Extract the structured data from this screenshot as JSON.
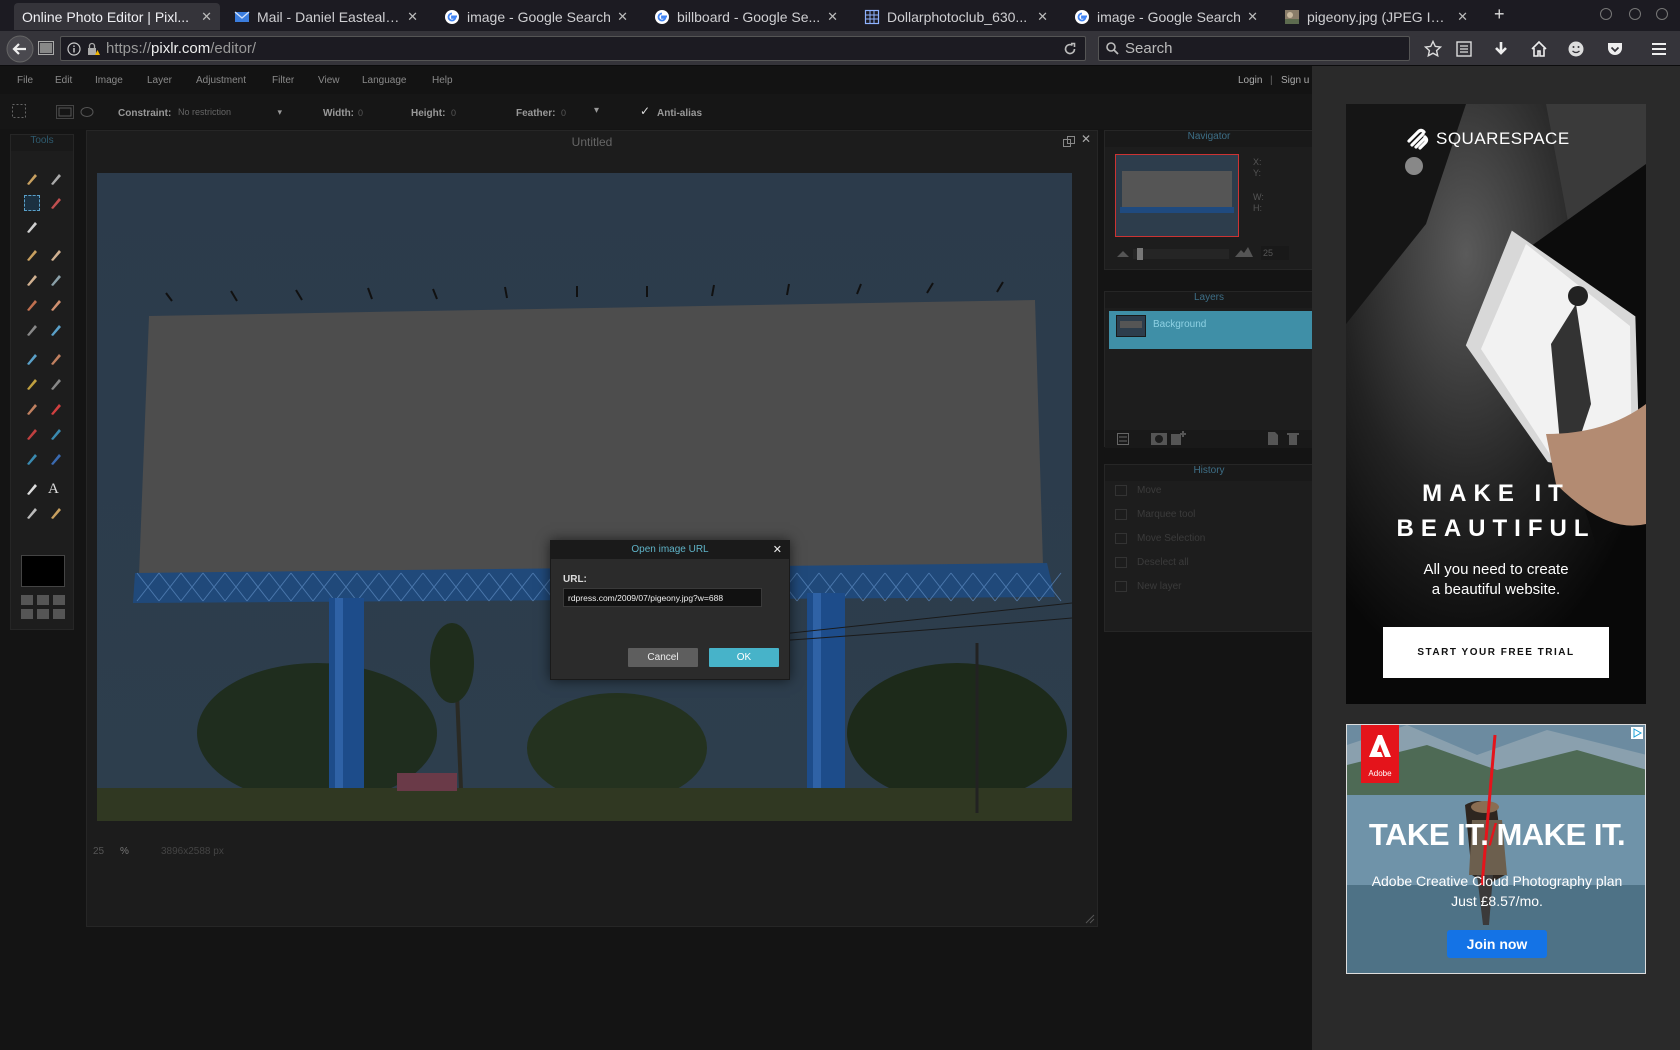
{
  "browser": {
    "tabs": [
      {
        "title": "Online Photo Editor | Pixl...",
        "favicon": "pixlr-icon",
        "active": true
      },
      {
        "title": "Mail - Daniel Easteal -...",
        "favicon": "mail-icon"
      },
      {
        "title": "image - Google Search",
        "favicon": "google-icon"
      },
      {
        "title": "billboard - Google Se...",
        "favicon": "google-icon"
      },
      {
        "title": "Dollarphotoclub_630...",
        "favicon": "image-file-icon"
      },
      {
        "title": "image - Google Search",
        "favicon": "google-icon"
      },
      {
        "title": "pigeony.jpg (JPEG Ima...",
        "favicon": "image-thumb-icon"
      }
    ],
    "url_prefix": "https://",
    "url_domain": "pixlr.com",
    "url_path": "/editor/",
    "search_placeholder": "Search"
  },
  "pixlr": {
    "menu": [
      "File",
      "Edit",
      "Image",
      "Layer",
      "Adjustment",
      "Filter",
      "View",
      "Language",
      "Help"
    ],
    "login": "Login",
    "separator": "|",
    "signup": "Sign u",
    "options": {
      "constraint_label": "Constraint:",
      "constraint_value": "No restriction",
      "width_label": "Width:",
      "width_value": "0",
      "height_label": "Height:",
      "height_value": "0",
      "feather_label": "Feather:",
      "feather_value": "0",
      "antialias_label": "Anti-alias",
      "antialias_checked": true
    },
    "tools_title": "Tools",
    "canvas_title": "Untitled",
    "status": {
      "zoom": "25",
      "unit": "%",
      "size": "3896x2588 px"
    },
    "navigator": {
      "title": "Navigator",
      "x": "X:",
      "y": "Y:",
      "w": "W:",
      "h": "H:",
      "zoom": "25"
    },
    "layers": {
      "title": "Layers",
      "items": [
        "Background"
      ]
    },
    "history": {
      "title": "History",
      "items": [
        "Move",
        "Marquee tool",
        "Move Selection",
        "Deselect all",
        "New layer"
      ]
    }
  },
  "dialog": {
    "title": "Open image URL",
    "url_label": "URL:",
    "url_value": "rdpress.com/2009/07/pigeony.jpg?w=688",
    "cancel": "Cancel",
    "ok": "OK"
  },
  "ads": {
    "squarespace": {
      "brand": "SQUARESPACE",
      "headline_line1": "MAKE IT",
      "headline_line2": "BEAUTIFUL",
      "tagline_line1": "All you need to create",
      "tagline_line2": "a beautiful website.",
      "cta": "START YOUR FREE TRIAL"
    },
    "adobe": {
      "logo_text": "Adobe",
      "headline_part1": "TAKE IT.",
      "headline_part2": "MAKE IT.",
      "line1": "Adobe Creative Cloud Photography plan",
      "line2": "Just £8.57/mo.",
      "cta": "Join now"
    }
  },
  "colors": {
    "accent": "#47b3c9",
    "layer_selected": "#3f8fa7",
    "adobe_red": "#e4141b",
    "join_blue": "#1473e6"
  }
}
